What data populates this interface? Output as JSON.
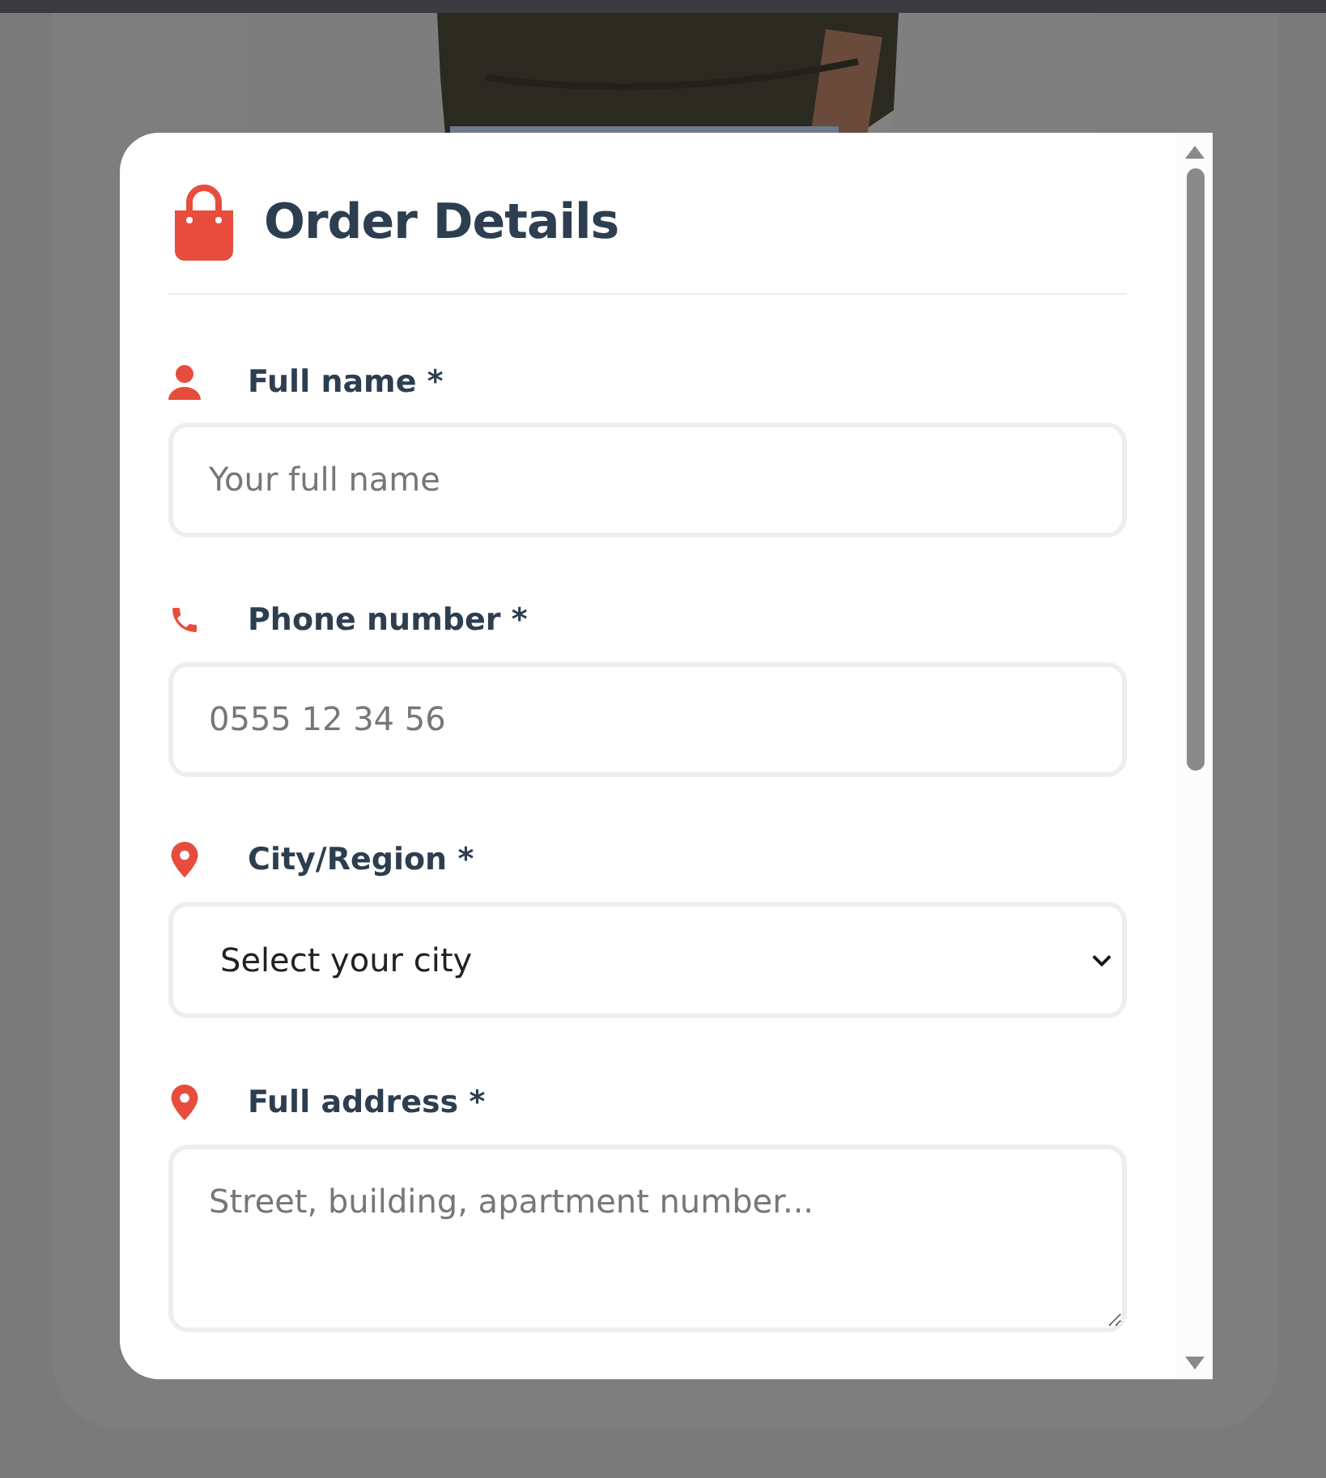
{
  "modal": {
    "title": "Order Details",
    "fields": [
      {
        "kind": "input",
        "label": "Full name *",
        "placeholder": "Your full name"
      },
      {
        "kind": "input",
        "label": "Phone number *",
        "placeholder": "0555 12 34 56"
      },
      {
        "kind": "select",
        "label": "City/Region *",
        "value": "Select your city"
      },
      {
        "kind": "textarea",
        "label": "Full address *",
        "placeholder": "Street, building, apartment number..."
      }
    ]
  }
}
